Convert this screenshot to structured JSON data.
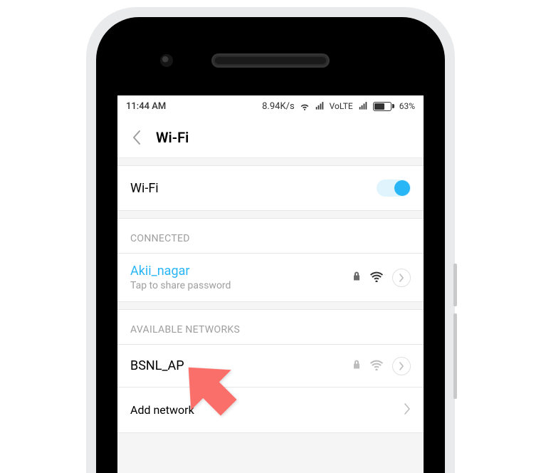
{
  "statusbar": {
    "time": "11:44 AM",
    "speed": "8.94K/s",
    "network_label": "VoLTE",
    "battery_pct_text": "63%",
    "battery_pct": 63
  },
  "header": {
    "title": "Wi-Fi"
  },
  "wifi_toggle": {
    "label": "Wi-Fi",
    "on": true
  },
  "sections": {
    "connected_label": "CONNECTED",
    "available_label": "AVAILABLE NETWORKS"
  },
  "connected_network": {
    "name": "Akii_nagar",
    "subtitle": "Tap to share password",
    "secured": true
  },
  "available_networks": [
    {
      "name": "BSNL_AP",
      "secured": true
    }
  ],
  "add_network_label": "Add network",
  "annotation": {
    "kind": "red-arrow",
    "color": "#fb6f6a"
  }
}
